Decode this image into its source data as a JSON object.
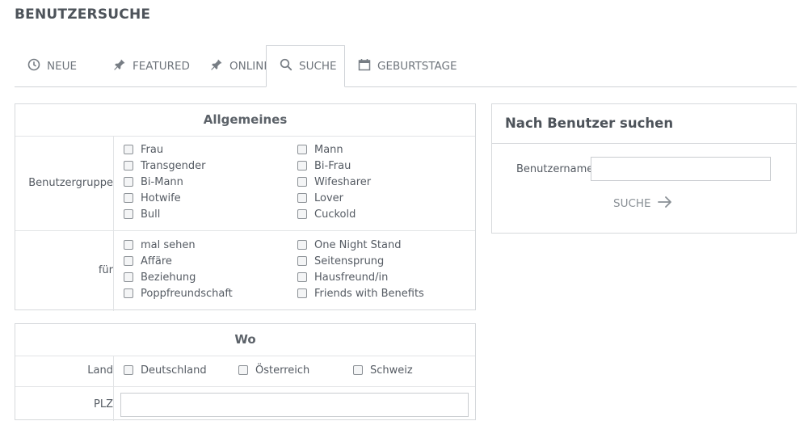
{
  "page": {
    "title": "BENUTZERSUCHE"
  },
  "tabs": [
    {
      "label": "NEUE",
      "icon": "clock-icon"
    },
    {
      "label": "FEATURED",
      "icon": "pin-icon"
    },
    {
      "label": "ONLINE",
      "icon": "pin-icon"
    },
    {
      "label": "SUCHE",
      "icon": "search-icon",
      "active": true
    },
    {
      "label": "GEBURTSTAGE",
      "icon": "calendar-icon"
    }
  ],
  "allgemeines": {
    "title": "Allgemeines",
    "benutzergruppe": {
      "label": "Benutzergruppe",
      "options": [
        "Frau",
        "Mann",
        "Transgender",
        "Bi-Frau",
        "Bi-Mann",
        "Wifesharer",
        "Hotwife",
        "Lover",
        "Bull",
        "Cuckold"
      ]
    },
    "fuer": {
      "label": "für",
      "options": [
        "mal sehen",
        "One Night Stand",
        "Affäre",
        "Seitensprung",
        "Beziehung",
        "Hausfreund/in",
        "Poppfreundschaft",
        "Friends with Benefits"
      ]
    }
  },
  "wo": {
    "title": "Wo",
    "land": {
      "label": "Land",
      "options": [
        "Deutschland",
        "Österreich",
        "Schweiz"
      ]
    },
    "plz": {
      "label": "PLZ",
      "value": ""
    }
  },
  "sidebar": {
    "title": "Nach Benutzer suchen",
    "username_label": "Benutzername",
    "username_value": "",
    "button_label": "SUCHE",
    "button_icon": "arrow-right-icon"
  },
  "colors": {
    "text": "#555b63",
    "border": "#d6d9dc",
    "muted": "#8a9096"
  }
}
